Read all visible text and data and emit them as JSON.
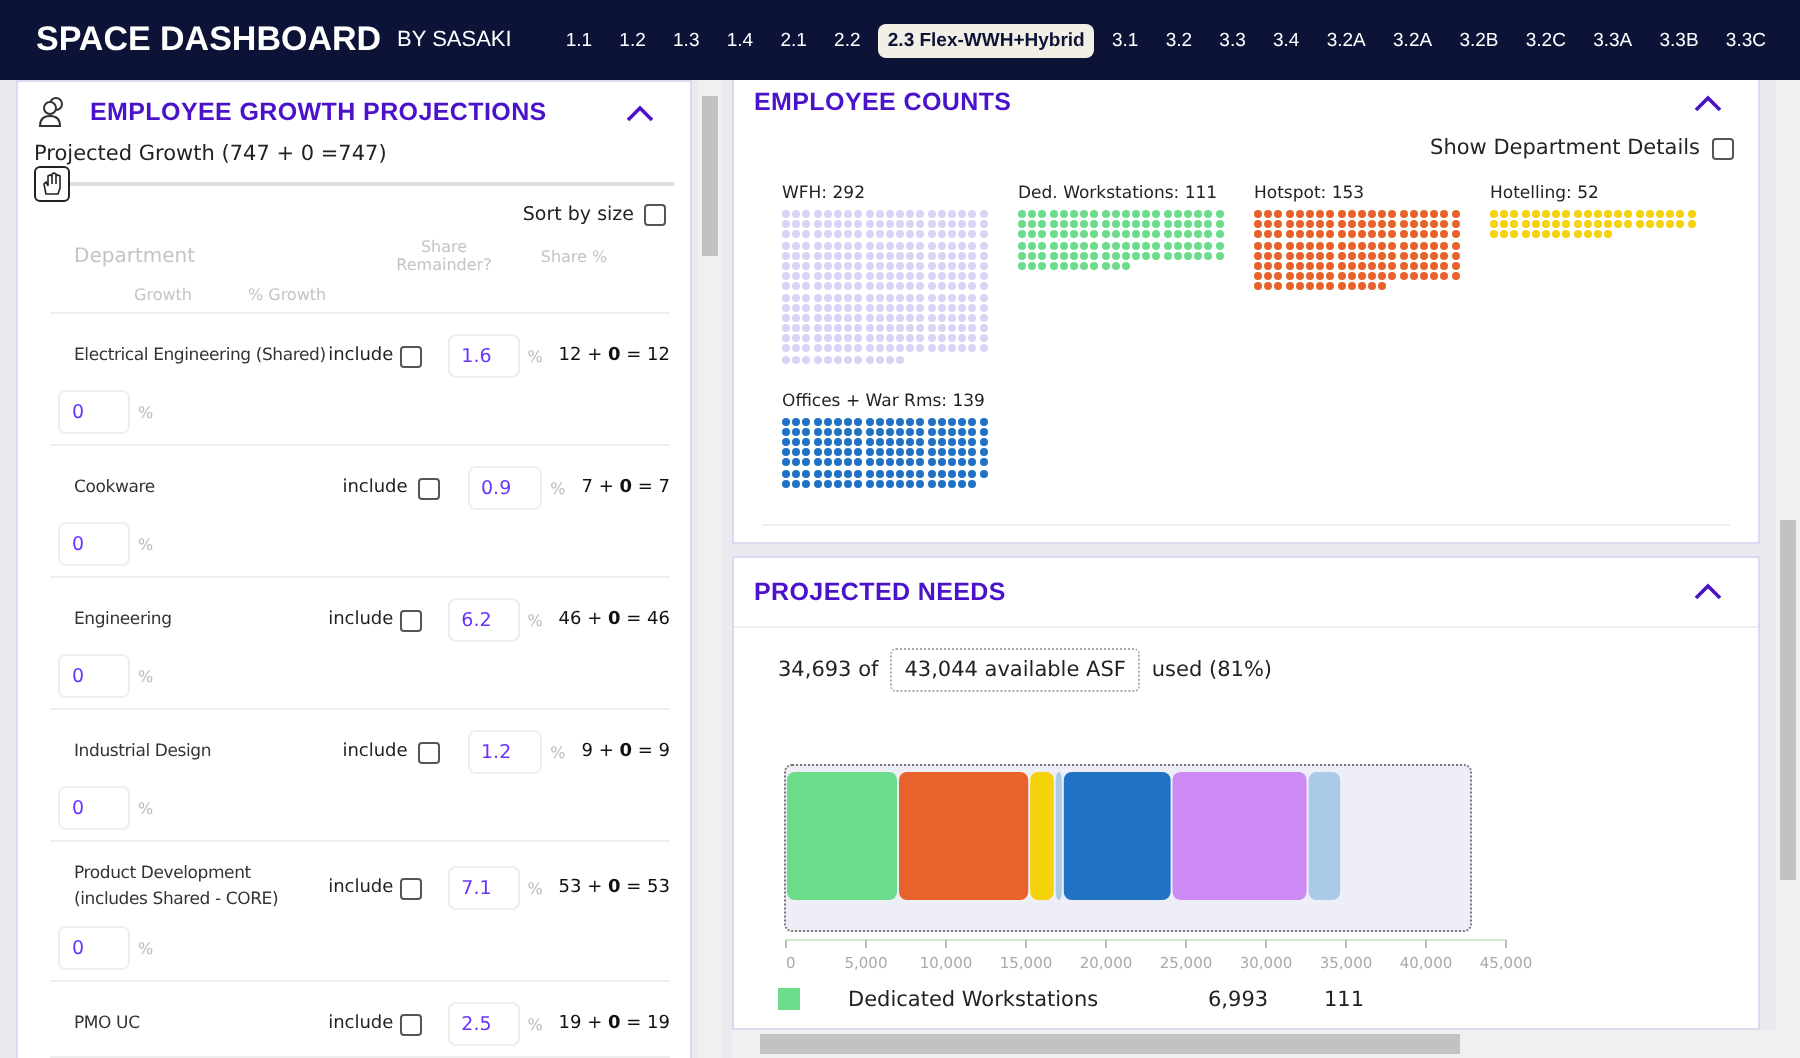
{
  "header": {
    "title": "SPACE DASHBOARD",
    "byline": "BY SASAKI",
    "tabs": [
      {
        "label": "1.1",
        "selected": false
      },
      {
        "label": "1.2",
        "selected": false
      },
      {
        "label": "1.3",
        "selected": false
      },
      {
        "label": "1.4",
        "selected": false
      },
      {
        "label": "2.1",
        "selected": false
      },
      {
        "label": "2.2",
        "selected": false
      },
      {
        "label": "2.3 Flex-WWH+Hybrid",
        "selected": true
      },
      {
        "label": "3.1",
        "selected": false
      },
      {
        "label": "3.2",
        "selected": false
      },
      {
        "label": "3.3",
        "selected": false
      },
      {
        "label": "3.4",
        "selected": false
      },
      {
        "label": "3.2A",
        "selected": false
      },
      {
        "label": "3.2A",
        "selected": false
      },
      {
        "label": "3.2B",
        "selected": false
      },
      {
        "label": "3.2C",
        "selected": false
      },
      {
        "label": "3.3A",
        "selected": false
      },
      {
        "label": "3.3B",
        "selected": false
      },
      {
        "label": "3.3C",
        "selected": false
      }
    ]
  },
  "growth_panel": {
    "title": "EMPLOYEE GROWTH PROJECTIONS",
    "expanded": true,
    "slider": {
      "label": "Projected Growth (747 + 0 =747)",
      "level": 0
    },
    "sort": {
      "label": "Sort by size",
      "checked": false
    },
    "columns": {
      "department": "Department",
      "share_remainder": "Share Remainder?",
      "share_pct": "Share %",
      "growth": "Growth",
      "pct_growth": "% Growth"
    },
    "rows": [
      {
        "name": "Electrical Engineering (Shared)",
        "include_label": "include",
        "include": false,
        "share": "1.6",
        "unit": "%",
        "formula": "12 + **0** = 12",
        "growth": "0",
        "growth_unit": "%"
      },
      {
        "name": "Cookware",
        "include_label": "include",
        "include": false,
        "share": "0.9",
        "unit": "%",
        "formula": "7 + **0** = 7",
        "growth": "0",
        "growth_unit": "%"
      },
      {
        "name": "Engineering",
        "include_label": "include",
        "include": false,
        "share": "6.2",
        "unit": "%",
        "formula": "46 + **0** = 46",
        "growth": "0",
        "growth_unit": "%"
      },
      {
        "name": "Industrial Design",
        "include_label": "include",
        "include": false,
        "share": "1.2",
        "unit": "%",
        "formula": "9 + **0** = 9",
        "growth": "0",
        "growth_unit": "%"
      },
      {
        "name": "Product Development (includes Shared - CORE)",
        "include_label": "include",
        "include": false,
        "share": "7.1",
        "unit": "%",
        "formula": "53 + **0** = 53",
        "growth": "0",
        "growth_unit": "%"
      },
      {
        "name": "PMO UC",
        "include_label": "include",
        "include": false,
        "share": "2.5",
        "unit": "%",
        "formula": "19 + **0** = 19"
      }
    ]
  },
  "counts_panel": {
    "title": "EMPLOYEE COUNTS",
    "expanded": true,
    "details": {
      "label": "Show Department Details",
      "checked": false
    },
    "groups": [
      {
        "label": "WFH: 292",
        "color": "#d9d3f5"
      },
      {
        "label": "Ded. Workstations: 111",
        "color": "#6bdc8a"
      },
      {
        "label": "Hotspot: 153",
        "color": "#e8632b"
      },
      {
        "label": "Hotelling: 52",
        "color": "#f5d20a"
      },
      {
        "label": "Offices + War Rms: 139",
        "color": "#2072c4"
      }
    ]
  },
  "needs_panel": {
    "title": "PROJECTED NEEDS",
    "expanded": true,
    "used": "34,693 of",
    "available": "43,044 available ASF",
    "used_pct": "used (81%)",
    "chart_data": {
      "type": "bar",
      "orientation": "horizontal",
      "stacked": true,
      "xlim": [
        0,
        45000
      ],
      "xticks": [
        {
          "value": 0,
          "label": "0"
        },
        {
          "value": 5000,
          "label": "5,000"
        },
        {
          "value": 10000,
          "label": "10,000"
        },
        {
          "value": 15000,
          "label": "15,000"
        },
        {
          "value": 20000,
          "label": "20,000"
        },
        {
          "value": 25000,
          "label": "25,000"
        },
        {
          "value": 30000,
          "label": "30,000"
        },
        {
          "value": 35000,
          "label": "35,000"
        },
        {
          "value": 40000,
          "label": "40,000"
        },
        {
          "value": 45000,
          "label": "45,000"
        }
      ],
      "series": [
        {
          "color": "#6bdc8a",
          "values": [
            7000
          ]
        },
        {
          "color": "#e8632b",
          "values": [
            8200
          ]
        },
        {
          "color": "#f5d20a",
          "values": [
            1600
          ]
        },
        {
          "color": "#a9cbe6",
          "values": [
            500
          ]
        },
        {
          "color": "#2072c4",
          "values": [
            6800
          ]
        },
        {
          "color": "#cd8af5",
          "values": [
            8500
          ]
        },
        {
          "color": "#a9cbe6",
          "values": [
            2100
          ]
        }
      ]
    },
    "legend": [
      {
        "color": "#6bdc8a",
        "name": "Dedicated Workstations",
        "asf": "6,993",
        "count": "111"
      }
    ]
  }
}
